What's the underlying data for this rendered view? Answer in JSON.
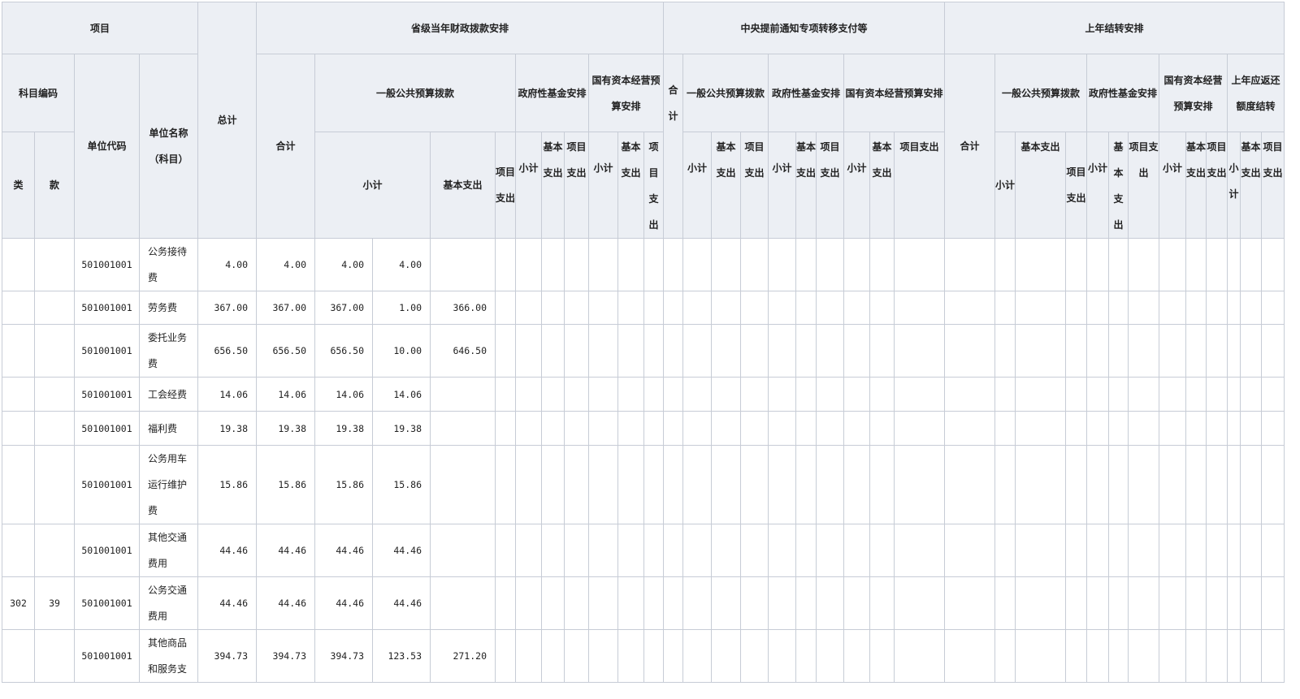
{
  "header": {
    "item": "项目",
    "subject_code": "科目编码",
    "class": "类",
    "section": "款",
    "unit_code": "单位代码",
    "unit_name": "单位名称（科目）",
    "grand_total": "总计",
    "provincial": "省级当年财政拨款安排",
    "central": "中央提前通知专项转移支付等",
    "carryover": "上年结转安排",
    "total": "合计",
    "general_budget": "一般公共预算拨款",
    "gov_fund": "政府性基金安排",
    "soe_budget": "国有资本经营预算安排",
    "central_general": "一般公共预算拨款",
    "central_gov_fund": "政府性基金安排",
    "central_soe": "国有资本经营预算安排",
    "carry_gov_fund": "政府性基金安排",
    "carry_soe": "国有资本经营预算安排",
    "return_quota": "上年应返还额度结转",
    "subtotal": "小计",
    "basic_exp": "基本支出",
    "project_exp": "项目支出"
  },
  "rows": [
    {
      "class": "",
      "section": "",
      "unit_code": "501001001",
      "name": "公务接待费",
      "grand_total": "4.00",
      "total": "4.00",
      "subtotal": "4.00",
      "basic": "4.00",
      "project": ""
    },
    {
      "class": "",
      "section": "",
      "unit_code": "501001001",
      "name": "劳务费",
      "grand_total": "367.00",
      "total": "367.00",
      "subtotal": "367.00",
      "basic": "1.00",
      "project": "366.00"
    },
    {
      "class": "",
      "section": "",
      "unit_code": "501001001",
      "name": "委托业务费",
      "grand_total": "656.50",
      "total": "656.50",
      "subtotal": "656.50",
      "basic": "10.00",
      "project": "646.50"
    },
    {
      "class": "",
      "section": "",
      "unit_code": "501001001",
      "name": "工会经费",
      "grand_total": "14.06",
      "total": "14.06",
      "subtotal": "14.06",
      "basic": "14.06",
      "project": ""
    },
    {
      "class": "",
      "section": "",
      "unit_code": "501001001",
      "name": "福利费",
      "grand_total": "19.38",
      "total": "19.38",
      "subtotal": "19.38",
      "basic": "19.38",
      "project": ""
    },
    {
      "class": "",
      "section": "",
      "unit_code": "501001001",
      "name": "公务用车运行维护费",
      "grand_total": "15.86",
      "total": "15.86",
      "subtotal": "15.86",
      "basic": "15.86",
      "project": ""
    },
    {
      "class": "",
      "section": "",
      "unit_code": "501001001",
      "name": "其他交通费用",
      "grand_total": "44.46",
      "total": "44.46",
      "subtotal": "44.46",
      "basic": "44.46",
      "project": ""
    },
    {
      "class": "302",
      "section": "39",
      "unit_code": "501001001",
      "name": "公务交通费用",
      "grand_total": "44.46",
      "total": "44.46",
      "subtotal": "44.46",
      "basic": "44.46",
      "project": ""
    },
    {
      "class": "",
      "section": "",
      "unit_code": "501001001",
      "name": "其他商品和服务支",
      "grand_total": "394.73",
      "total": "394.73",
      "subtotal": "394.73",
      "basic": "123.53",
      "project": "271.20"
    }
  ]
}
